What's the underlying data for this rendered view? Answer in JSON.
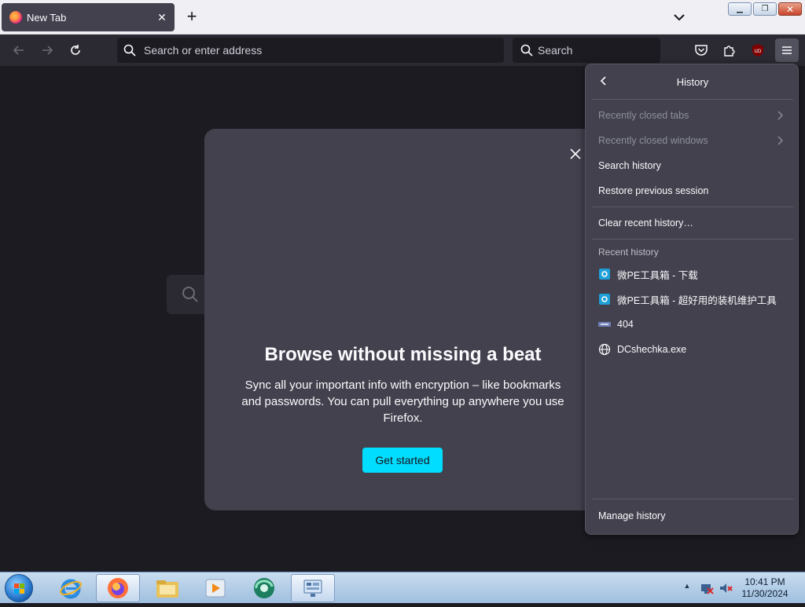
{
  "tab": {
    "title": "New Tab",
    "close_symbol": "✕"
  },
  "toolbar": {
    "url_placeholder": "Search or enter address",
    "search_placeholder": "Search",
    "ublock_badge": "UD"
  },
  "modal": {
    "heading": "Browse without missing a beat",
    "body": "Sync all your important info with encryption – like bookmarks and passwords. You can pull everything up anywhere you use Firefox.",
    "button_label": "Get started"
  },
  "history_panel": {
    "title": "History",
    "items": [
      {
        "label": "Recently closed tabs",
        "enabled": false
      },
      {
        "label": "Recently closed windows",
        "enabled": false
      },
      {
        "label": "Search history",
        "enabled": true
      },
      {
        "label": "Restore previous session",
        "enabled": true
      }
    ],
    "clear_label": "Clear recent history…",
    "recent_label": "Recent history",
    "recent": [
      {
        "label": "微PE工具箱 - 下载",
        "icon": "wepe-icon"
      },
      {
        "label": "微PE工具箱 - 超好用的装机维护工具",
        "icon": "wepe-icon"
      },
      {
        "label": "404",
        "icon": "site-icon"
      },
      {
        "label": "DCshechka.exe",
        "icon": "globe-icon"
      }
    ],
    "manage_label": "Manage history"
  },
  "taskbar": {
    "time": "10:41 PM",
    "date": "11/30/2024"
  },
  "colors": {
    "accent": "#00ddff",
    "panel_bg": "#42414d",
    "toolbar_bg": "#2b2a33",
    "content_bg": "#1c1b22"
  }
}
